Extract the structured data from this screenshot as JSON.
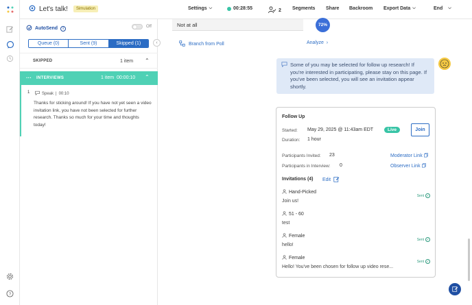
{
  "app": {
    "title": "Let's talk!",
    "badge": "Simulation"
  },
  "topnav": {
    "settings": "Settings",
    "timer": "00:28:55",
    "participants_count": "2",
    "segments": "Segments",
    "share": "Share",
    "backroom": "Backroom",
    "export_data": "Export Data",
    "end": "End"
  },
  "left_rail": {
    "icons": [
      "logo-icon",
      "edit-icon",
      "chat-icon",
      "history-icon",
      "settings-icon",
      "help-icon"
    ]
  },
  "left_panel": {
    "autosend_label": "AutoSend",
    "autosend_state": "Off",
    "tabs": [
      {
        "label": "Queue (0)",
        "active": false
      },
      {
        "label": "Sent (9)",
        "active": false
      },
      {
        "label": "Skipped (1)",
        "active": true
      }
    ],
    "skipped": {
      "label": "SKIPPED",
      "count": "1 item"
    },
    "interviews": {
      "label": "INTERVIEWS",
      "count": "1 item",
      "duration": "00:00:10"
    },
    "item": {
      "number": "1",
      "type": "Speak",
      "time": "00:10",
      "text": "Thanks for sticking around! If you have not yet seen a video invitation link, you have not been selected for further research. Thanks so much for your time and thoughts today!"
    }
  },
  "main": {
    "poll_option": "Not at all",
    "poll_percent": "72%",
    "branch_from_poll": "Branch from Poll",
    "analyze": "Analyze",
    "message": "Some of you may be selected for follow up research! If you're interested in participating, please stay on this page. If you've been selected, you will see an invitation appear shortly.",
    "follow_up": {
      "title": "Follow Up",
      "started_label": "Started:",
      "started_value": "May 29, 2025 @ 11:43am EDT",
      "status": "Live",
      "join": "Join",
      "duration_label": "Duration:",
      "duration_value": "1 hour",
      "invited_label": "Participants Invited:",
      "invited_value": "23",
      "in_interview_label": "Participants in Interview:",
      "in_interview_value": "0",
      "moderator_link": "Moderator Link",
      "observer_link": "Observer Link",
      "invitations_label": "Invitations (4)",
      "edit": "Edit",
      "invitations": [
        {
          "segment": "Hand-Picked",
          "message": "Join us!",
          "status": "Sent"
        },
        {
          "segment": "51 - 60",
          "message": "test",
          "status": ""
        },
        {
          "segment": "Female",
          "message": "hello!",
          "status": "Sent"
        },
        {
          "segment": "Female",
          "message": "Hello! You've been chosen for follow up video rese...",
          "status": "Sent"
        }
      ]
    }
  },
  "colors": {
    "accent": "#2b6cc4",
    "teal": "#4fd1b5",
    "live": "#38c4a6",
    "message_bg": "#dfe9f7",
    "badge_bg": "#f7efb6"
  }
}
